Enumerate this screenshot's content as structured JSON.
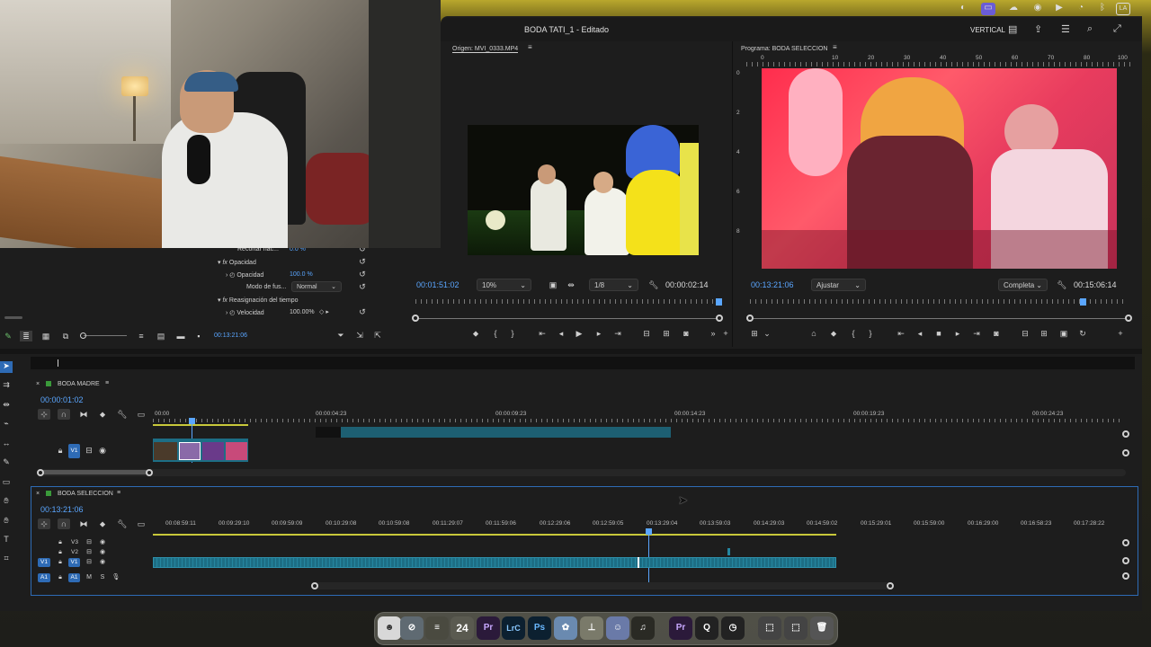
{
  "window": {
    "title": "BODA TATI_1 - Editado",
    "layout_label": "VERTICAL"
  },
  "source_monitor": {
    "label": "Origen: MVI_0333.MP4",
    "timecode": "00:01:51:02",
    "zoom": "10%",
    "resolution": "1/8",
    "duration": "00:00:02:14"
  },
  "program_monitor": {
    "label": "Programa: BODA SELECCION",
    "timecode": "00:13:21:06",
    "fit": "Ajustar",
    "quality": "Completa",
    "duration": "00:15:06:14",
    "ruler": [
      "0",
      "10",
      "20",
      "30",
      "40",
      "50",
      "60",
      "70",
      "80",
      "90",
      "100"
    ],
    "vruler": [
      "0",
      "2",
      "4",
      "6",
      "8"
    ]
  },
  "effect_controls": {
    "crop_label": "Recortar nac...",
    "crop_value": "0.0 %",
    "opacity_section": "Opacidad",
    "opacity_label": "Opacidad",
    "opacity_value": "100.0 %",
    "blend_label": "Modo de fus...",
    "blend_value": "Normal",
    "time_remap": "Reasignación del tiempo",
    "speed_label": "Velocidad",
    "speed_value": "100.00%",
    "timecode": "00:13:21:06"
  },
  "timeline_madre": {
    "name": "BODA MADRE",
    "timecode": "00:00:01:02",
    "ruler": [
      "00:00",
      "00:00:04:23",
      "00:00:09:23",
      "00:00:14:23",
      "00:00:19:23",
      "00:00:24:23"
    ],
    "track": "V1"
  },
  "timeline_seleccion": {
    "name": "BODA SELECCION",
    "timecode": "00:13:21:06",
    "ruler": [
      "00:08:59:11",
      "00:09:29:10",
      "00:09:59:09",
      "00:10:29:08",
      "00:10:59:08",
      "00:11:29:07",
      "00:11:59:06",
      "00:12:29:06",
      "00:12:59:05",
      "00:13:29:04",
      "00:13:59:03",
      "00:14:29:03",
      "00:14:59:02",
      "00:15:29:01",
      "00:15:59:00",
      "00:16:29:00",
      "00:16:58:23",
      "00:17:28:22"
    ],
    "tracks": [
      "V3",
      "V2",
      "V1",
      "A1"
    ]
  },
  "dock": {
    "calendar_day": "24",
    "items": [
      "Finder",
      "Safari",
      "Notes",
      "Calendar",
      "Premiere Pro",
      "Lightroom Classic",
      "Photoshop",
      "Pixelmator",
      "Keynote",
      "Discord",
      "Music",
      "Premiere Pro",
      "QuickTime",
      "Activity",
      "Folder",
      "Trash"
    ]
  },
  "colors": {
    "accent": "#5aa6ff",
    "clip": "#1d6e85",
    "badge": "#2e6bb5"
  }
}
